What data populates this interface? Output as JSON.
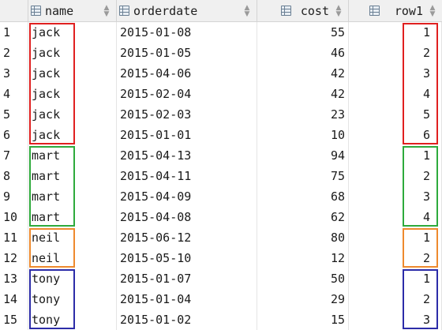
{
  "columns": [
    {
      "label": "name",
      "icon": "table-column-icon"
    },
    {
      "label": "orderdate",
      "icon": "table-column-icon"
    },
    {
      "label": "cost",
      "icon": "table-column-icon"
    },
    {
      "label": "row1",
      "icon": "table-column-icon"
    }
  ],
  "rows": [
    {
      "num": "1",
      "name": "jack",
      "orderdate": "2015-01-08",
      "cost": "55",
      "row1": "1"
    },
    {
      "num": "2",
      "name": "jack",
      "orderdate": "2015-01-05",
      "cost": "46",
      "row1": "2"
    },
    {
      "num": "3",
      "name": "jack",
      "orderdate": "2015-04-06",
      "cost": "42",
      "row1": "3"
    },
    {
      "num": "4",
      "name": "jack",
      "orderdate": "2015-02-04",
      "cost": "42",
      "row1": "4"
    },
    {
      "num": "5",
      "name": "jack",
      "orderdate": "2015-02-03",
      "cost": "23",
      "row1": "5"
    },
    {
      "num": "6",
      "name": "jack",
      "orderdate": "2015-01-01",
      "cost": "10",
      "row1": "6"
    },
    {
      "num": "7",
      "name": "mart",
      "orderdate": "2015-04-13",
      "cost": "94",
      "row1": "1"
    },
    {
      "num": "8",
      "name": "mart",
      "orderdate": "2015-04-11",
      "cost": "75",
      "row1": "2"
    },
    {
      "num": "9",
      "name": "mart",
      "orderdate": "2015-04-09",
      "cost": "68",
      "row1": "3"
    },
    {
      "num": "10",
      "name": "mart",
      "orderdate": "2015-04-08",
      "cost": "62",
      "row1": "4"
    },
    {
      "num": "11",
      "name": "neil",
      "orderdate": "2015-06-12",
      "cost": "80",
      "row1": "1"
    },
    {
      "num": "12",
      "name": "neil",
      "orderdate": "2015-05-10",
      "cost": "12",
      "row1": "2"
    },
    {
      "num": "13",
      "name": "tony",
      "orderdate": "2015-01-07",
      "cost": "50",
      "row1": "1"
    },
    {
      "num": "14",
      "name": "tony",
      "orderdate": "2015-01-04",
      "cost": "29",
      "row1": "2"
    },
    {
      "num": "15",
      "name": "tony",
      "orderdate": "2015-01-02",
      "cost": "15",
      "row1": "3"
    }
  ],
  "groups": [
    {
      "name": "jack",
      "color": "#e02020"
    },
    {
      "name": "mart",
      "color": "#2eaa3c"
    },
    {
      "name": "neil",
      "color": "#ee8a2e"
    },
    {
      "name": "tony",
      "color": "#2c2ca8"
    }
  ],
  "sort_icon": "sort-arrows-icon"
}
